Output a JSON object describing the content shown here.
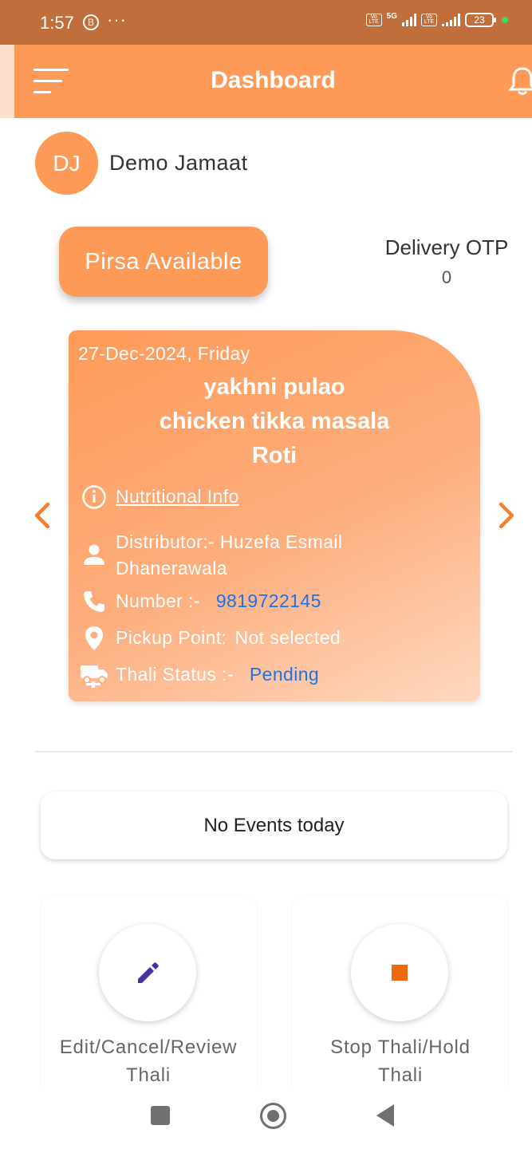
{
  "status_bar": {
    "time": "1:57",
    "b_icon_label": "B",
    "dots": "···",
    "network": "5G",
    "volte_label": "Vo LTE",
    "battery": "23"
  },
  "app_bar": {
    "title": "Dashboard"
  },
  "profile": {
    "initials": "DJ",
    "name": "Demo Jamaat"
  },
  "pirsa_button": "Pirsa Available",
  "delivery_otp": {
    "label": "Delivery OTP",
    "value": "0"
  },
  "meal_card": {
    "date": "27-Dec-2024, Friday",
    "items": [
      "yakhni pulao",
      "chicken tikka masala",
      "Roti"
    ],
    "nutritional_info": "Nutritional Info",
    "distributor_label": "Distributor:-",
    "distributor_name_line1": "Huzefa Esmail",
    "distributor_name_line2": "Dhanerawala",
    "number_label": "Number :-",
    "number_value": "9819722145",
    "pickup_label": "Pickup Point:",
    "pickup_value": "Not selected",
    "status_label": "Thali Status :-",
    "status_value": "Pending"
  },
  "events": {
    "text": "No Events today"
  },
  "actions": [
    {
      "line1": "Edit/Cancel/Review",
      "line2": "Thali"
    },
    {
      "line1": "Stop Thali/Hold",
      "line2": "Thali"
    }
  ],
  "colors": {
    "accent": "#fe9a58",
    "status_bar": "#c16e3d",
    "link": "#1b73e8",
    "edit_icon": "#4a2ea8",
    "stop_icon": "#ec6a0c"
  }
}
